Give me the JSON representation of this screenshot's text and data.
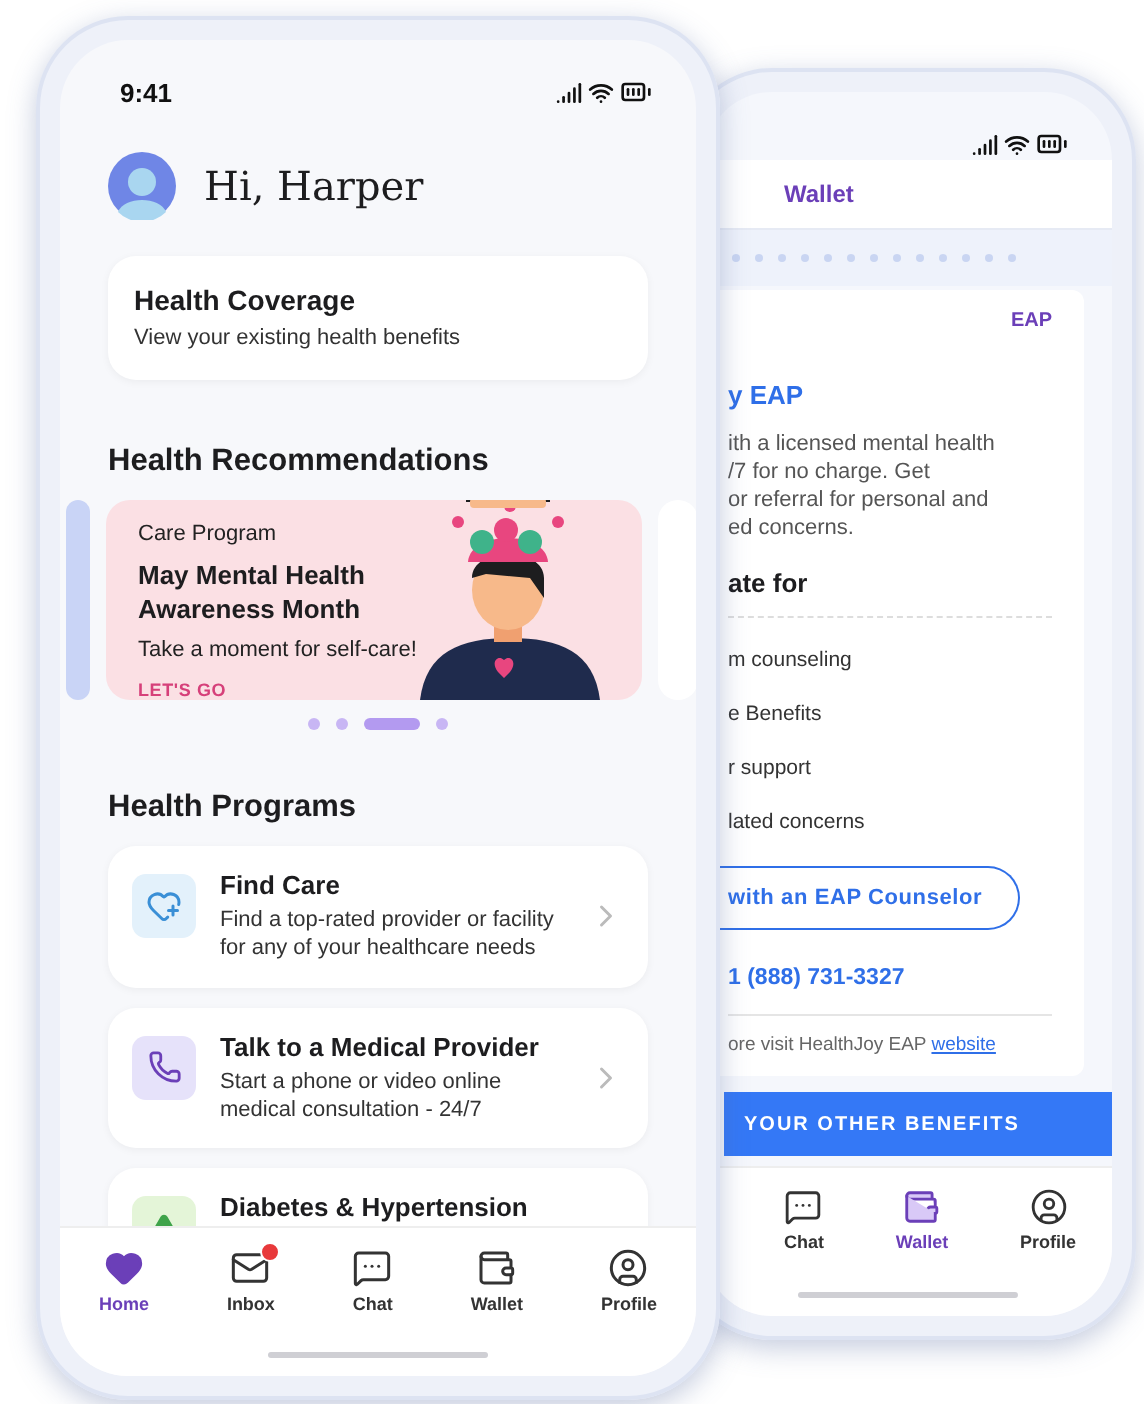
{
  "front_phone": {
    "status_bar": {
      "time": "9:41"
    },
    "greeting": "Hi, Harper",
    "coverage_card": {
      "title": "Health Coverage",
      "subtitle": "View your existing health benefits"
    },
    "recommendations": {
      "heading": "Health Recommendations",
      "card": {
        "label": "Care Program",
        "title": "May Mental Health Awareness Month",
        "subtitle": "Take a moment for self-care!",
        "action": "LET'S GO"
      },
      "dots": [
        {
          "selected": false
        },
        {
          "selected": false
        },
        {
          "selected": true
        },
        {
          "selected": false
        }
      ]
    },
    "programs": {
      "heading": "Health Programs",
      "items": [
        {
          "kind": "heart",
          "title": "Find Care",
          "description": "Find a top-rated provider or facility for any of your healthcare needs"
        },
        {
          "kind": "phone",
          "title": "Talk to a Medical Provider",
          "description": "Start a phone or video online medical consultation - 24/7"
        },
        {
          "kind": "triangle",
          "title": "Diabetes & Hypertension"
        }
      ]
    },
    "tab_bar": [
      {
        "kind": "heart",
        "label": "Home",
        "selected": true,
        "badge": false
      },
      {
        "kind": "mail",
        "label": "Inbox",
        "selected": false,
        "badge": true
      },
      {
        "kind": "chat",
        "label": "Chat",
        "selected": false,
        "badge": false
      },
      {
        "kind": "wallet",
        "label": "Wallet",
        "selected": false,
        "badge": false
      },
      {
        "kind": "profile",
        "label": "Profile",
        "selected": false,
        "badge": false
      }
    ]
  },
  "back_phone": {
    "header": "Wallet",
    "card": {
      "tag": "EAP",
      "title": "y EAP",
      "description": [
        "ith a licensed mental health",
        "/7 for no charge. Get",
        "or referral for personal and",
        "ed concerns."
      ],
      "section_heading": "ate for",
      "list": [
        "m counseling",
        "e Benefits",
        "r support",
        "lated concerns"
      ],
      "button": "with an EAP Counselor",
      "phone": "1 (888) 731-3327",
      "footer": "ore visit HealthJoy EAP",
      "footer_link": "website"
    },
    "banner": "YOUR OTHER BENEFITS",
    "tab_bar": [
      {
        "kind": "chat",
        "label": "Chat",
        "selected": false
      },
      {
        "kind": "wallet",
        "label": "Wallet",
        "selected": true
      },
      {
        "kind": "profile",
        "label": "Profile",
        "selected": false
      }
    ]
  }
}
